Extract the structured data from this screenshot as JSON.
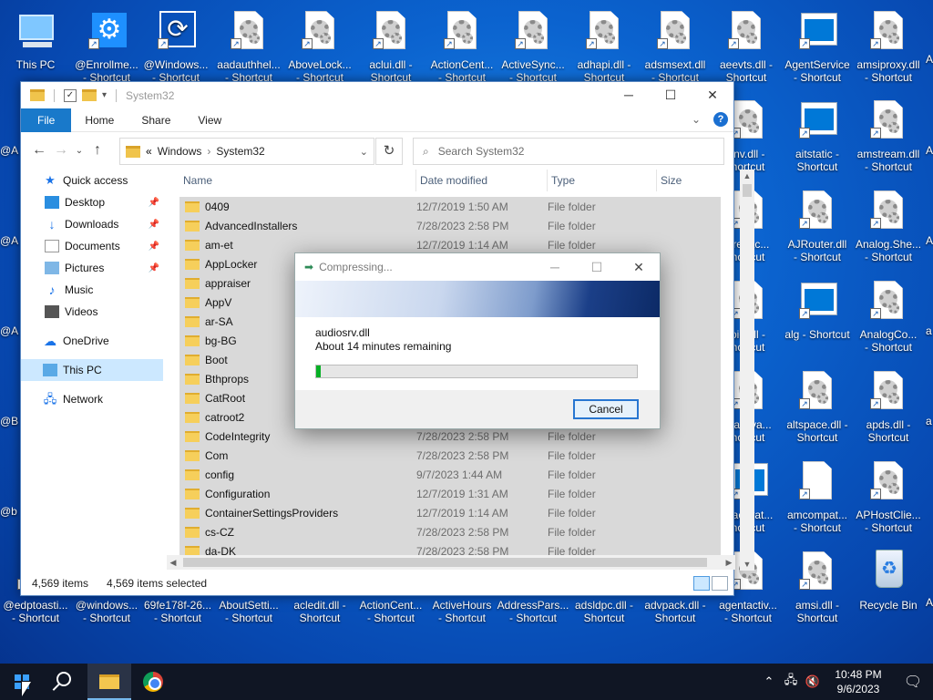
{
  "desktop": {
    "icons_top": [
      {
        "name": "this-pc-icon",
        "l1": "This PC",
        "l2": ""
      },
      {
        "name": "enrollment-shortcut-icon",
        "l1": "@Enrollme...",
        "l2": "- Shortcut"
      },
      {
        "name": "windows-shortcut-icon",
        "l1": "@Windows...",
        "l2": "- Shortcut"
      },
      {
        "name": "aadauthhelper-shortcut-icon",
        "l1": "aadauthhel...",
        "l2": "- Shortcut"
      },
      {
        "name": "abovelock-shortcut-icon",
        "l1": "AboveLock...",
        "l2": "- Shortcut"
      },
      {
        "name": "aclui-shortcut-icon",
        "l1": "aclui.dll -",
        "l2": "Shortcut"
      },
      {
        "name": "actioncenter-shortcut-icon",
        "l1": "ActionCent...",
        "l2": "- Shortcut"
      },
      {
        "name": "activesync-shortcut-icon",
        "l1": "ActiveSync...",
        "l2": "- Shortcut"
      },
      {
        "name": "adhapi-shortcut-icon",
        "l1": "adhapi.dll -",
        "l2": "Shortcut"
      },
      {
        "name": "adsmsext-shortcut-icon",
        "l1": "adsmsext.dll",
        "l2": "- Shortcut"
      },
      {
        "name": "aeevts-shortcut-icon",
        "l1": "aeevts.dll -",
        "l2": "Shortcut"
      },
      {
        "name": "agentservice-shortcut-icon",
        "l1": "AgentService",
        "l2": "- Shortcut"
      },
      {
        "name": "amsiproxy-shortcut-icon",
        "l1": "amsiproxy.dll",
        "l2": "- Shortcut"
      }
    ],
    "icons_right": [
      {
        "name": "inv-shortcut-icon",
        "l1": "inv.dll -",
        "l2": "hortcut"
      },
      {
        "name": "aitstatic-shortcut-icon",
        "l1": "aitstatic -",
        "l2": "Shortcut"
      },
      {
        "name": "amstream-shortcut-icon",
        "l1": "amstream.dll",
        "l2": "- Shortcut"
      },
      {
        "name": "arebac-shortcut-icon",
        "l1": "arebac...",
        "l2": "hortcut"
      },
      {
        "name": "ajrouter-shortcut-icon",
        "l1": "AJRouter.dll",
        "l2": "- Shortcut"
      },
      {
        "name": "analogshell-shortcut-icon",
        "l1": "Analog.She...",
        "l2": "- Shortcut"
      },
      {
        "name": "pic-shortcut-icon",
        "l1": "pic.dll -",
        "l2": "hortcut"
      },
      {
        "name": "alg-shortcut-icon",
        "l1": "alg - Shortcut",
        "l2": ""
      },
      {
        "name": "analogco-shortcut-icon",
        "l1": "AnalogCo...",
        "l2": "- Shortcut"
      },
      {
        "name": "agentactiva-shortcut-icon",
        "l1": "ntactiva...",
        "l2": "hortcut"
      },
      {
        "name": "altspace-shortcut-icon",
        "l1": "altspace.dll -",
        "l2": "Shortcut"
      },
      {
        "name": "apds-shortcut-icon",
        "l1": "apds.dll -",
        "l2": "Shortcut"
      },
      {
        "name": "agentactivat-shortcut-icon",
        "l1": "ntactivat...",
        "l2": "hortcut"
      },
      {
        "name": "amcompat-shortcut-icon",
        "l1": "amcompat...",
        "l2": "- Shortcut"
      },
      {
        "name": "aphostclient-shortcut-icon",
        "l1": "APHostClie...",
        "l2": "- Shortcut"
      },
      {
        "name": "agentactiv-shortcut-icon",
        "l1": "agentactiv...",
        "l2": "- Shortcut"
      },
      {
        "name": "amsi-shortcut-icon",
        "l1": "amsi.dll -",
        "l2": "Shortcut"
      },
      {
        "name": "recycle-bin-icon",
        "l1": "Recycle Bin",
        "l2": ""
      }
    ],
    "icons_bottom": [
      {
        "name": "edptoast-shortcut-icon",
        "l1": "@edptoasti...",
        "l2": "- Shortcut"
      },
      {
        "name": "windows2-shortcut-icon",
        "l1": "@windows...",
        "l2": "- Shortcut"
      },
      {
        "name": "guid-shortcut-icon",
        "l1": "69fe178f-26...",
        "l2": "- Shortcut"
      },
      {
        "name": "aboutsettings-shortcut-icon",
        "l1": "AboutSetti...",
        "l2": "- Shortcut"
      },
      {
        "name": "acledit-shortcut-icon",
        "l1": "acledit.dll -",
        "l2": "Shortcut"
      },
      {
        "name": "actioncenter2-shortcut-icon",
        "l1": "ActionCent...",
        "l2": "- Shortcut"
      },
      {
        "name": "activehours-shortcut-icon",
        "l1": "ActiveHours",
        "l2": "- Shortcut"
      },
      {
        "name": "addressparser-shortcut-icon",
        "l1": "AddressPars...",
        "l2": "- Shortcut"
      },
      {
        "name": "adsldpc-shortcut-icon",
        "l1": "adsldpc.dll -",
        "l2": "Shortcut"
      },
      {
        "name": "advpack-shortcut-icon",
        "l1": "advpack.dll -",
        "l2": "Shortcut"
      }
    ],
    "edge_left": [
      "@A",
      "@A",
      "@A",
      "@B",
      "@b"
    ],
    "edge_right": [
      "A",
      "A",
      "A",
      "a",
      "a",
      "A"
    ]
  },
  "explorer": {
    "title": "System32",
    "ribbon_tabs": [
      "File",
      "Home",
      "Share",
      "View"
    ],
    "address": {
      "prefix": "«",
      "crumbs": [
        "Windows",
        "System32"
      ]
    },
    "search_placeholder": "Search System32",
    "nav": [
      {
        "label": "Quick access",
        "icon": "star-icon",
        "pinned": false,
        "indent": 1
      },
      {
        "label": "Desktop",
        "icon": "desktop-icon",
        "pinned": true,
        "indent": 2
      },
      {
        "label": "Downloads",
        "icon": "download-icon",
        "pinned": true,
        "indent": 2
      },
      {
        "label": "Documents",
        "icon": "documents-icon",
        "pinned": true,
        "indent": 2
      },
      {
        "label": "Pictures",
        "icon": "pictures-icon",
        "pinned": true,
        "indent": 2
      },
      {
        "label": "Music",
        "icon": "music-icon",
        "pinned": false,
        "indent": 2
      },
      {
        "label": "Videos",
        "icon": "videos-icon",
        "pinned": false,
        "indent": 2
      },
      {
        "label": "OneDrive",
        "icon": "cloud-icon",
        "pinned": false,
        "indent": 1
      },
      {
        "label": "This PC",
        "icon": "pc-icon",
        "pinned": false,
        "indent": 1,
        "selected": true
      },
      {
        "label": "Network",
        "icon": "network-icon",
        "pinned": false,
        "indent": 1
      }
    ],
    "columns": [
      "Name",
      "Date modified",
      "Type",
      "Size"
    ],
    "rows": [
      {
        "name": "0409",
        "date": "12/7/2019 1:50 AM",
        "type": "File folder"
      },
      {
        "name": "AdvancedInstallers",
        "date": "7/28/2023 2:58 PM",
        "type": "File folder"
      },
      {
        "name": "am-et",
        "date": "12/7/2019 1:14 AM",
        "type": "File folder"
      },
      {
        "name": "AppLocker",
        "date": "",
        "type": ""
      },
      {
        "name": "appraiser",
        "date": "",
        "type": ""
      },
      {
        "name": "AppV",
        "date": "",
        "type": ""
      },
      {
        "name": "ar-SA",
        "date": "",
        "type": ""
      },
      {
        "name": "bg-BG",
        "date": "",
        "type": ""
      },
      {
        "name": "Boot",
        "date": "",
        "type": ""
      },
      {
        "name": "Bthprops",
        "date": "",
        "type": ""
      },
      {
        "name": "CatRoot",
        "date": "",
        "type": ""
      },
      {
        "name": "catroot2",
        "date": "",
        "type": ""
      },
      {
        "name": "CodeIntegrity",
        "date": "7/28/2023 2:58 PM",
        "type": "File folder"
      },
      {
        "name": "Com",
        "date": "7/28/2023 2:58 PM",
        "type": "File folder"
      },
      {
        "name": "config",
        "date": "9/7/2023 1:44 AM",
        "type": "File folder"
      },
      {
        "name": "Configuration",
        "date": "12/7/2019 1:31 AM",
        "type": "File folder"
      },
      {
        "name": "ContainerSettingsProviders",
        "date": "12/7/2019 1:14 AM",
        "type": "File folder"
      },
      {
        "name": "cs-CZ",
        "date": "7/28/2023 2:58 PM",
        "type": "File folder"
      },
      {
        "name": "da-DK",
        "date": "7/28/2023 2:58 PM",
        "type": "File folder"
      }
    ],
    "status": {
      "items": "4,569 items",
      "selected": "4,569 items selected"
    }
  },
  "dialog": {
    "title": "Compressing...",
    "filename": "audiosrv.dll",
    "remaining": "About 14 minutes remaining",
    "progress": 0.015,
    "cancel": "Cancel"
  },
  "taskbar": {
    "time": "10:48 PM",
    "date": "9/6/2023"
  }
}
